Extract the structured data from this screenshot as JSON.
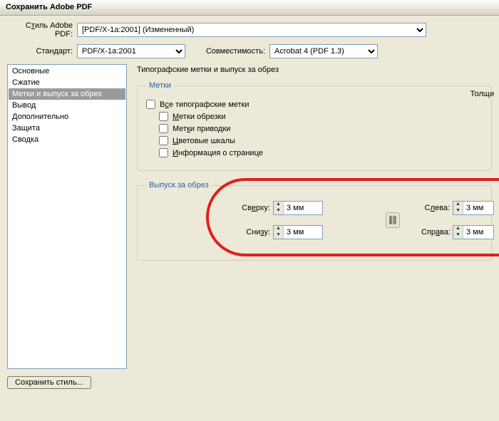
{
  "window": {
    "title": "Сохранить Adobe PDF"
  },
  "top": {
    "style_label_pre": "С",
    "style_label_mid": "т",
    "style_label_post": "иль Adobe PDF:",
    "style_value": "[PDF/X-1a:2001] (Измененный)",
    "standard_label": "Стандарт:",
    "standard_value": "PDF/X-1a:2001",
    "compat_label": "Совместимость:",
    "compat_value": "Acrobat 4 (PDF 1.3)"
  },
  "sidebar": {
    "items": [
      "Основные",
      "Сжатие",
      "Метки и выпуск за обрез",
      "Вывод",
      "Дополнительно",
      "Защита",
      "Сводка"
    ],
    "selected_index": 2
  },
  "panel": {
    "title": "Типографские метки и выпуск за обрез",
    "marks": {
      "legend": "Метки",
      "all_pre": "В",
      "all_u": "с",
      "all_post": "е типографские метки",
      "trim_u": "М",
      "trim_post": "етки обрезки",
      "reg_pre": "Мет",
      "reg_u": "к",
      "reg_post": "и приводки",
      "color_u": "Ц",
      "color_post": "ветовые шкалы",
      "page_u": "И",
      "page_post": "нформация о странице",
      "truncated_label": "Толщи"
    },
    "bleed": {
      "legend": "Выпуск за обрез",
      "top_label_pre": "Св",
      "top_label_u": "е",
      "top_label_post": "рху:",
      "bottom_label_pre": "Сни",
      "bottom_label_u": "з",
      "bottom_label_post": "у:",
      "left_label_pre": "С",
      "left_label_u": "л",
      "left_label_post": "ева:",
      "right_label_pre": "Спр",
      "right_label_u": "а",
      "right_label_post": "ва:",
      "top_value": "3 мм",
      "bottom_value": "3 мм",
      "left_value": "3 мм",
      "right_value": "3 мм",
      "link_glyph": "⛓"
    }
  },
  "buttons": {
    "save_style": "Сохранить стиль..."
  }
}
